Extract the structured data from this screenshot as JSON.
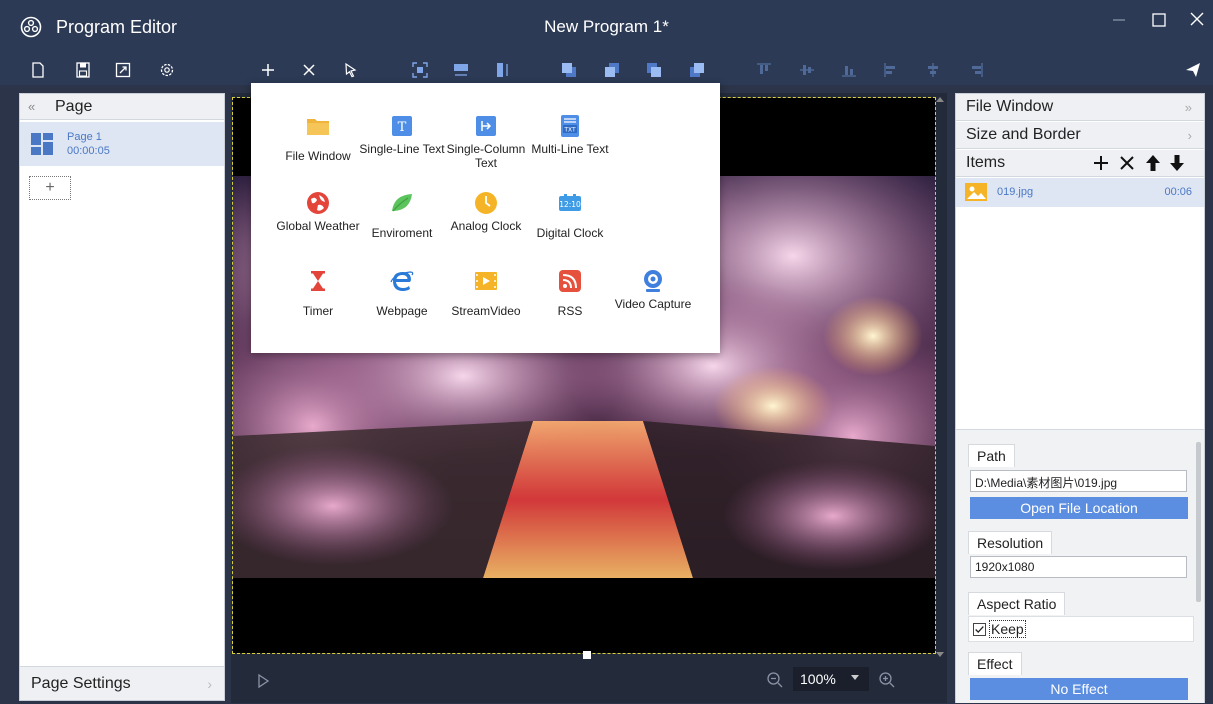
{
  "window": {
    "app_title": "Program Editor",
    "document_title": "New Program 1*"
  },
  "toolbar": {
    "icons": [
      "new-file-icon",
      "save-icon",
      "resize-icon",
      "settings-icon",
      "add-icon",
      "delete-icon",
      "select-icon",
      "fit-icon",
      "fit-width-icon",
      "fit-height-icon",
      "bring-front-icon",
      "bring-forward-icon",
      "send-backward-icon",
      "send-back-icon",
      "align-top-icon",
      "align-vcenter-icon",
      "align-bottom-icon",
      "align-left-icon",
      "align-hcenter-icon",
      "align-right-icon",
      "publish-icon"
    ]
  },
  "insert_menu": {
    "items": [
      {
        "label": "File Window",
        "icon": "folder-icon"
      },
      {
        "label": "Single-Line Text",
        "icon": "single-line-text-icon"
      },
      {
        "label": "Single-Column Text",
        "icon": "single-column-text-icon"
      },
      {
        "label": "Multi-Line Text",
        "icon": "multi-line-text-icon"
      },
      {
        "label": "Global Weather",
        "icon": "globe-icon"
      },
      {
        "label": "Enviroment",
        "icon": "leaf-icon"
      },
      {
        "label": "Analog Clock",
        "icon": "analog-clock-icon"
      },
      {
        "label": "Digital Clock",
        "icon": "digital-clock-icon"
      },
      {
        "label": "Timer",
        "icon": "hourglass-icon"
      },
      {
        "label": "Webpage",
        "icon": "browser-icon"
      },
      {
        "label": "StreamVideo",
        "icon": "stream-video-icon"
      },
      {
        "label": "RSS",
        "icon": "rss-icon"
      },
      {
        "label": "Video Capture",
        "icon": "webcam-icon"
      }
    ],
    "digital_clock_text": "12:10",
    "multi_line_badge": "TXT",
    "single_line_glyph": "T"
  },
  "left_panel": {
    "title": "Page",
    "collapse_glyph": "«",
    "pages": [
      {
        "name": "Page 1",
        "duration": "00:00:05"
      }
    ],
    "add_glyph": "+",
    "page_settings_label": "Page Settings",
    "page_settings_chevron": "›"
  },
  "canvas": {
    "zoom": "100%"
  },
  "right_panel": {
    "file_window_label": "File Window",
    "file_window_chevron": "»",
    "size_border_label": "Size and Border",
    "size_border_chevron": "›",
    "items_label": "Items",
    "items": [
      {
        "name": "019.jpg",
        "duration": "00:06"
      }
    ],
    "props": {
      "path_label": "Path",
      "path_value": "D:\\Media\\素材图片\\019.jpg",
      "open_location_label": "Open File Location",
      "resolution_label": "Resolution",
      "resolution_value": "1920x1080",
      "aspect_label": "Aspect Ratio",
      "keep_label": "Keep",
      "keep_checked": true,
      "effect_label": "Effect",
      "effect_value": "No Effect"
    }
  },
  "colors": {
    "titlebar": "#2c3a56",
    "accent": "#5b8ee0",
    "selection": "#dfe6f3",
    "canvas_border": "#d9cf3a",
    "link_text": "#4a78c4"
  }
}
